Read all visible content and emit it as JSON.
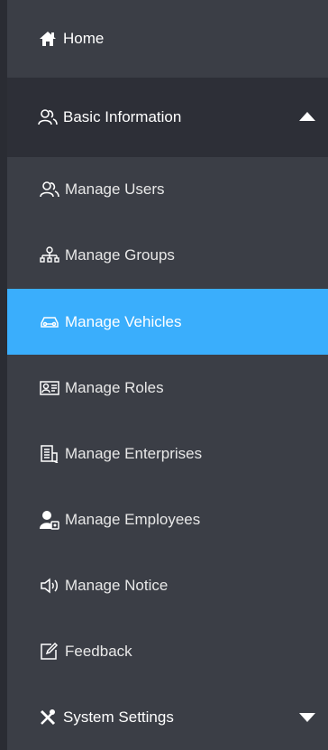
{
  "sidebar": {
    "items": [
      {
        "label": "Home",
        "icon": "home-icon"
      },
      {
        "label": "Basic Information",
        "icon": "users-icon",
        "expanded": true
      },
      {
        "label": "Manage Users",
        "icon": "users-icon"
      },
      {
        "label": "Manage Groups",
        "icon": "org-chart-icon"
      },
      {
        "label": "Manage Vehicles",
        "icon": "car-icon",
        "active": true
      },
      {
        "label": "Manage Roles",
        "icon": "id-card-icon"
      },
      {
        "label": "Manage Enterprises",
        "icon": "building-icon"
      },
      {
        "label": "Manage Employees",
        "icon": "employee-icon"
      },
      {
        "label": "Manage Notice",
        "icon": "speaker-icon"
      },
      {
        "label": "Feedback",
        "icon": "edit-icon"
      },
      {
        "label": "System Settings",
        "icon": "tools-icon",
        "expanded": false
      }
    ]
  },
  "colors": {
    "sidebar_bg": "#3b3e46",
    "group_header_bg": "#2d2f37",
    "active_bg": "#3aaefc",
    "text": "#ffffff"
  }
}
